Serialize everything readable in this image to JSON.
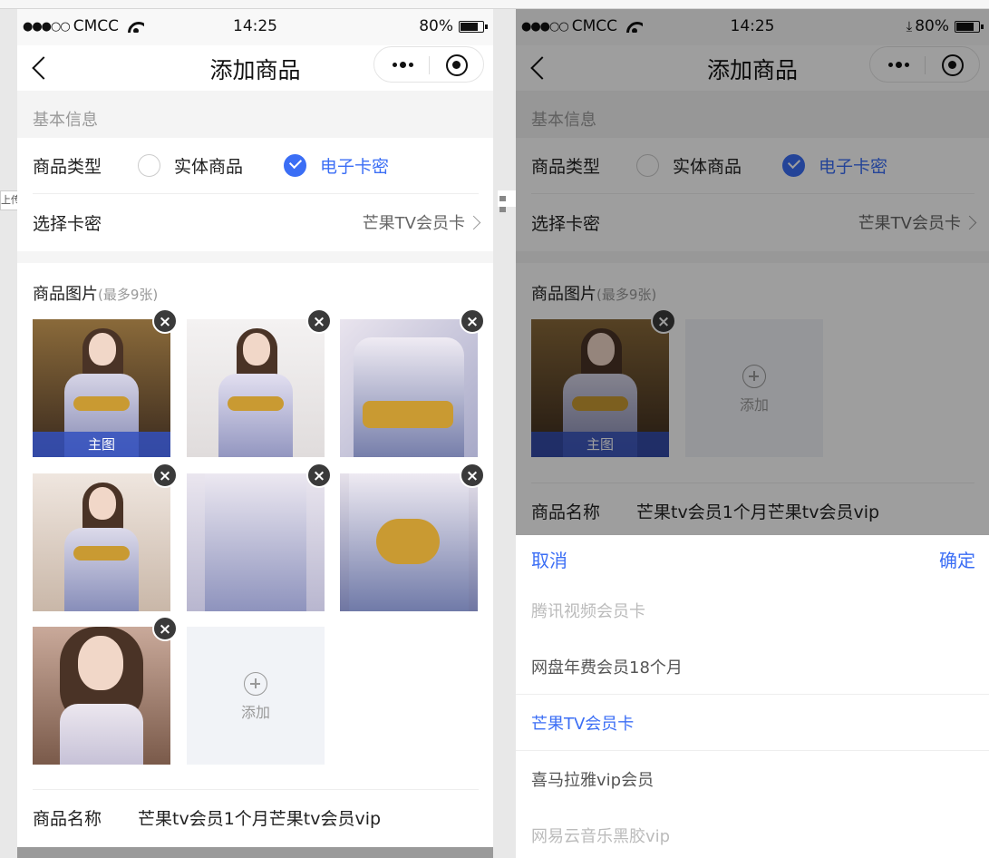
{
  "status": {
    "carrier": "CMCC",
    "time": "14:25",
    "battery": "80%",
    "battery_level": 0.8
  },
  "nav": {
    "title": "添加商品"
  },
  "basic": {
    "section_title": "基本信息"
  },
  "type_row": {
    "label": "商品类型",
    "option_physical": "实体商品",
    "option_digital": "电子卡密",
    "selected": "电子卡密"
  },
  "card_row": {
    "label": "选择卡密",
    "value": "芒果TV会员卡"
  },
  "images": {
    "title": "商品图片",
    "hint": "(最多9张)",
    "main_badge": "主图",
    "add_label": "添加",
    "delete_symbol": "×"
  },
  "name_row": {
    "label": "商品名称",
    "value": "芒果tv会员1个月芒果tv会员vip"
  },
  "picker": {
    "cancel": "取消",
    "confirm": "确定",
    "options": [
      "腾讯视频会员卡",
      "网盘年费会员18个月",
      "芒果TV会员卡",
      "喜马拉雅vip会员",
      "网易云音乐黑胶vip"
    ],
    "selected": "芒果TV会员卡"
  },
  "left_stub": "上传",
  "colors": {
    "accent": "#3b6ef5",
    "bg": "#f5f5f5",
    "overlay": "rgba(0,0,0,0.38)"
  }
}
